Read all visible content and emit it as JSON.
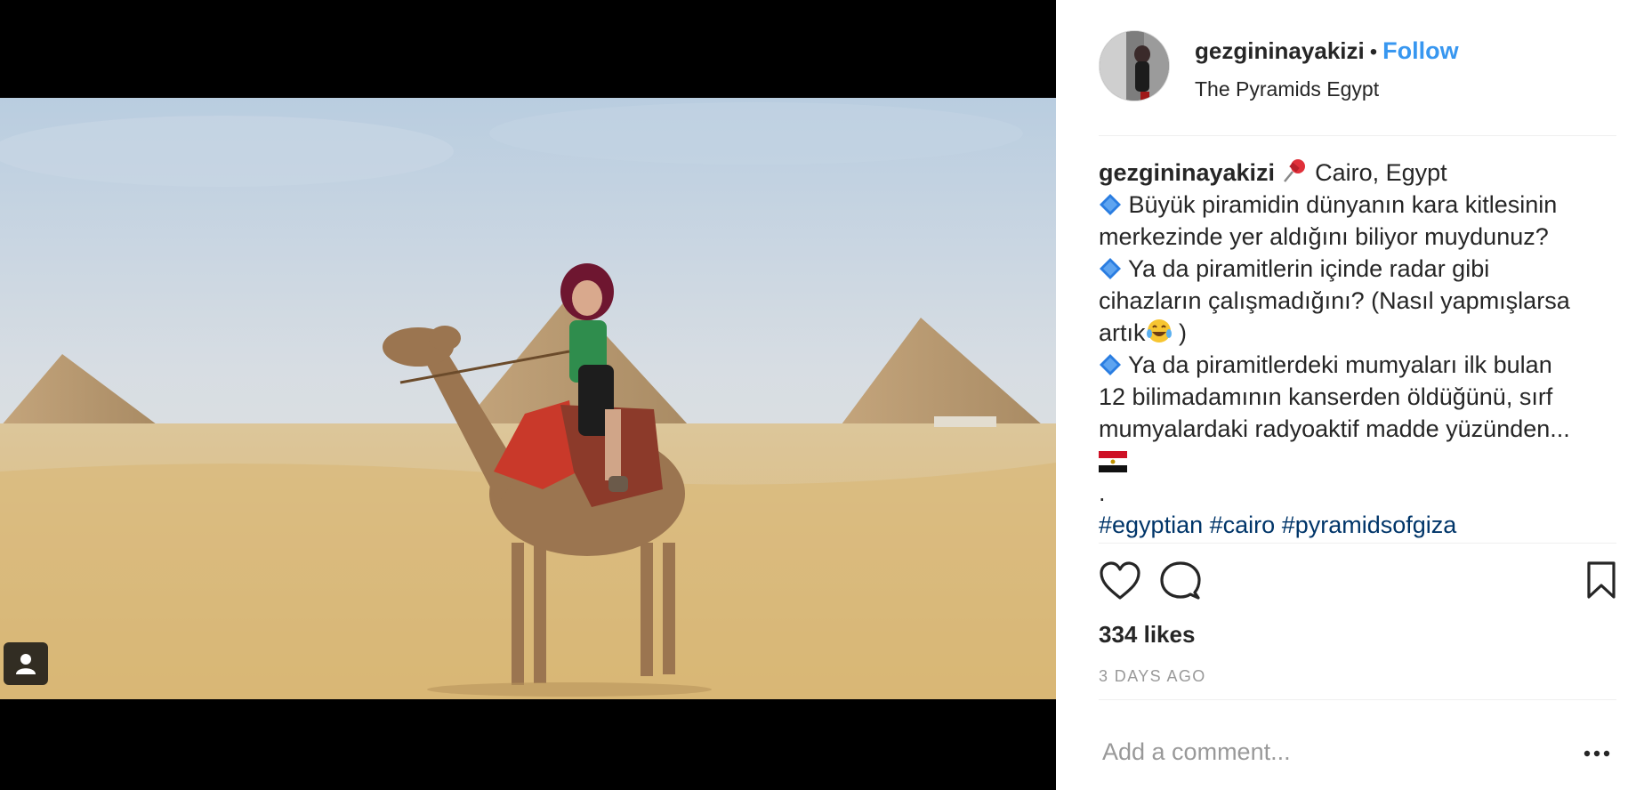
{
  "post": {
    "username": "gezgininayakizi",
    "separator": "•",
    "follow_label": "Follow",
    "location": "The Pyramids Egypt"
  },
  "caption": {
    "username": "gezgininayakizi",
    "line1_text": "Cairo, Egypt",
    "line2_text": "Büyük piramidin dünyanın kara kitlesinin",
    "line3_text": "merkezinde yer aldığını biliyor muydunuz?",
    "line4_text": "Ya da piramitlerin içinde radar gibi",
    "line5_text": "cihazların çalışmadığını? (Nasıl yapmışlarsa",
    "line6_text": "artık",
    "line6_tail": " )",
    "line7_text": "Ya da piramitlerdeki mumyaları ilk bulan",
    "line8_text": "12 bilimadamının kanserden öldüğünü, sırf",
    "line9_text": "mumyalardaki radyoaktif madde yüzünden...",
    "line11_text": ".",
    "hashtags": [
      "#egyptian",
      "#cairo",
      "#pyramidsofgiza"
    ]
  },
  "stats": {
    "likes": "334 likes",
    "time": "3 DAYS AGO"
  },
  "comment": {
    "placeholder": "Add a comment..."
  },
  "icons": {
    "like": "heart-icon",
    "comment": "comment-bubble-icon",
    "save": "bookmark-icon",
    "more": "more-options-icon",
    "tag": "user-tag-icon",
    "pin": "pushpin-emoji",
    "diamond": "blue-diamond-emoji",
    "laugh": "tears-of-joy-emoji",
    "flag": "egypt-flag-emoji"
  },
  "colors": {
    "follow": "#3897f0",
    "hashtag": "#003569",
    "muted": "#999999",
    "text": "#262626"
  }
}
